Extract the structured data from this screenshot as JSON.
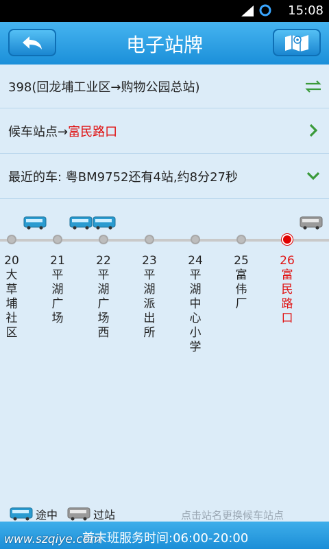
{
  "status": {
    "time": "15:08"
  },
  "header": {
    "title": "电子站牌"
  },
  "route": {
    "name": "398(回龙埔工业区→购物公园总站)"
  },
  "waiting": {
    "prefix": "候车站点→",
    "station": "富民路口"
  },
  "nearest": {
    "text": "最近的车: 粤BM9752还有4站,约8分27秒"
  },
  "stops": [
    {
      "num": "20",
      "name": "大草埔社区"
    },
    {
      "num": "21",
      "name": "平湖广场"
    },
    {
      "num": "22",
      "name": "平湖广场西"
    },
    {
      "num": "23",
      "name": "平湖派出所"
    },
    {
      "num": "24",
      "name": "平湖中心小学"
    },
    {
      "num": "25",
      "name": "富伟厂"
    },
    {
      "num": "26",
      "name": "富民路口",
      "current": true
    }
  ],
  "legend": {
    "enroute": "途中",
    "passed": "过站"
  },
  "hint": "点击站名更换候车站点",
  "footer": {
    "service_time": "首末班服务时间:06:00-20:00",
    "watermark": "www.szqiye.com"
  },
  "colors": {
    "accent": "#1b8fd9",
    "current": "#e01010",
    "icon_green": "#3a9a3a"
  }
}
